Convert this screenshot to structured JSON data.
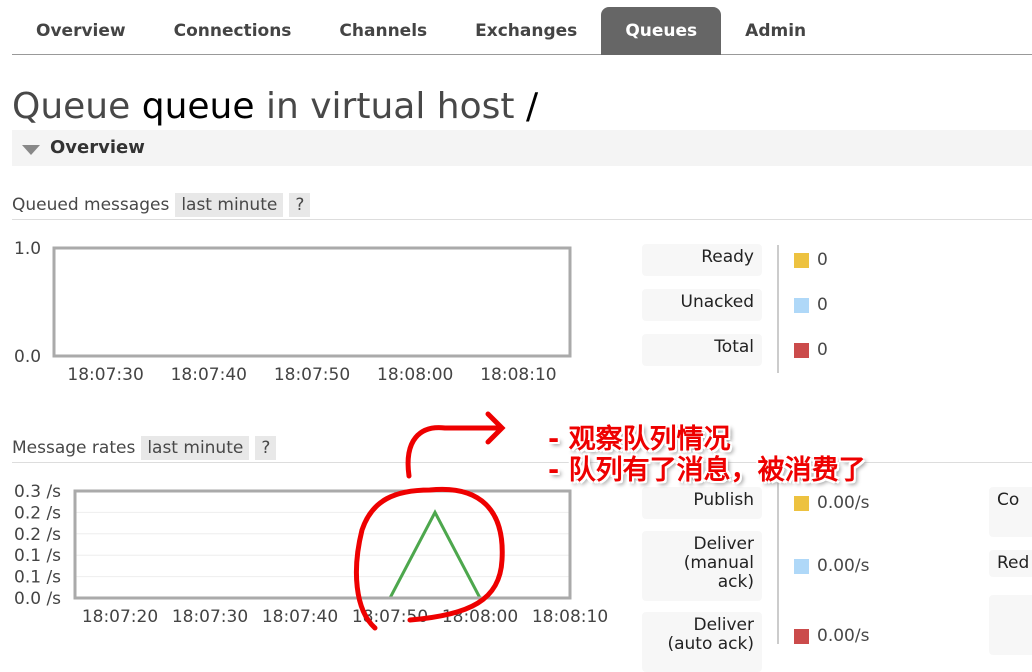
{
  "nav": {
    "tabs": [
      "Overview",
      "Connections",
      "Channels",
      "Exchanges",
      "Queues",
      "Admin"
    ],
    "active": "Queues"
  },
  "title": {
    "prefix": "Queue",
    "name": "queue",
    "middle": "in virtual host",
    "vhost": "/"
  },
  "overview_section": "Overview",
  "queued": {
    "label": "Queued messages",
    "range": "last minute",
    "help": "?",
    "legend": [
      {
        "label": "Ready",
        "value": "0",
        "color": "#edc240"
      },
      {
        "label": "Unacked",
        "value": "0",
        "color": "#afd8f8"
      },
      {
        "label": "Total",
        "value": "0",
        "color": "#cb4b4b"
      }
    ]
  },
  "rates": {
    "label": "Message rates",
    "range": "last minute",
    "help": "?",
    "legend": [
      {
        "label": "Publish",
        "value": "0.00/s",
        "color": "#edc240"
      },
      {
        "label": "Deliver (manual ack)",
        "value": "0.00/s",
        "color": "#afd8f8"
      },
      {
        "label": "Deliver (auto ack)",
        "value": "0.00/s",
        "color": "#cb4b4b"
      }
    ],
    "right_labels": [
      "Co",
      "Red"
    ]
  },
  "annotations": [
    "- 观察队列情况",
    "- 队列有了消息，被消费了"
  ],
  "annotation_color": "#e00000",
  "chart_data": [
    {
      "type": "line",
      "xlim": [
        "18:07:25",
        "18:08:15"
      ],
      "ylim": [
        0,
        1.0
      ],
      "yticks": [
        "1.0",
        "0.0"
      ],
      "xticks": [
        "18:07:30",
        "18:07:40",
        "18:07:50",
        "18:08:00",
        "18:08:10"
      ],
      "series": [
        {
          "color": "#cb4b4b",
          "x": [
            "18:07:25",
            "18:08:15"
          ],
          "y": [
            0,
            0
          ]
        }
      ]
    },
    {
      "type": "line",
      "xlim": [
        "18:07:15",
        "18:08:10"
      ],
      "ylim": [
        0,
        0.3
      ],
      "yticks": [
        "0.3 /s",
        "0.2 /s",
        "0.2 /s",
        "0.1 /s",
        "0.1 /s",
        "0.0 /s"
      ],
      "xticks": [
        "18:07:20",
        "18:07:30",
        "18:07:40",
        "18:07:50",
        "18:08:00",
        "18:08:10"
      ],
      "series": [
        {
          "color": "#7777cc",
          "x": [
            "18:07:15",
            "18:08:10"
          ],
          "y": [
            0,
            0
          ]
        },
        {
          "color": "#4da74d",
          "x": [
            "18:07:50",
            "18:07:55",
            "18:08:00"
          ],
          "y": [
            0,
            0.24,
            0
          ]
        }
      ]
    }
  ]
}
